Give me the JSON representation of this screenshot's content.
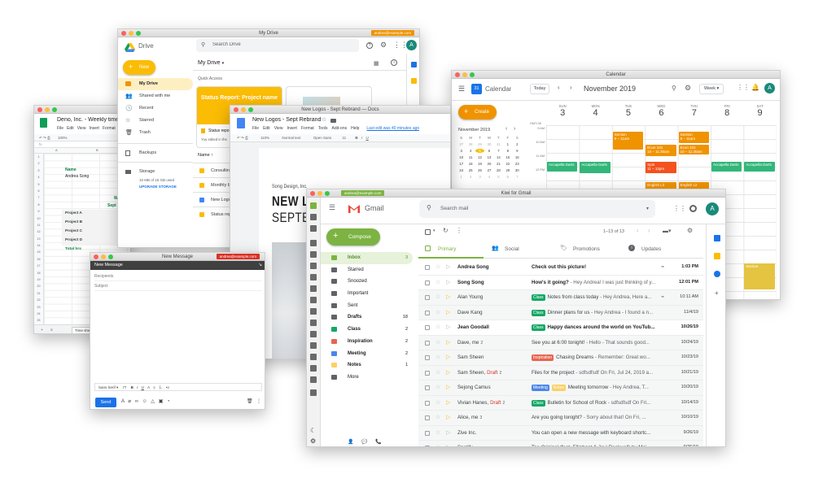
{
  "sheets": {
    "doc_title": "Deno, Inc. - Weekly time s",
    "menu": [
      "File",
      "Edit",
      "View",
      "Insert",
      "Format",
      "Da"
    ],
    "zoom": "100%",
    "fx": "fx",
    "name_label": "Name",
    "name_value": "Andrea Song",
    "partial_w": "W",
    "partial_sept": "Sept",
    "rows": [
      "Project A",
      "Project B",
      "Project C",
      "Project D",
      "Total hrs"
    ],
    "row_numbers": [
      "1",
      "2",
      "3",
      "4",
      "5",
      "6",
      "7",
      "8",
      "9",
      "10",
      "11",
      "12",
      "13",
      "14",
      "15",
      "16",
      "17",
      "18",
      "19",
      "20",
      "21",
      "22",
      "23",
      "24",
      "25"
    ],
    "cols": [
      "A",
      "B",
      "C"
    ],
    "tab_label": "Time she"
  },
  "drive": {
    "window_title": "My Drive",
    "tag": "andrea@example.com",
    "logo_text": "Drive",
    "search_placeholder": "Search Drive",
    "new_label": "New",
    "breadcrumb": "My Drive",
    "nav": [
      "My Drive",
      "Shared with me",
      "Recent",
      "Starred",
      "Trash",
      "Backups",
      "Storage"
    ],
    "storage_text": "10 MB of 15 GB used",
    "upgrade": "UPGRADE STORAGE",
    "quick_access": "Quick Access",
    "card_title": "Status Report: Project name",
    "card_file": "Status repo",
    "card_sub": "You edited in the",
    "name_header": "Name",
    "files": [
      "Consulting",
      "Monthly b",
      "New Logos",
      "Status rep"
    ],
    "avatar": "A"
  },
  "docs": {
    "title": "New Logos - Sept Rebrand",
    "window_title": "New Logos - Sept Rebrand — Docs",
    "menu": [
      "File",
      "Edit",
      "View",
      "Insert",
      "Format",
      "Tools",
      "Add-ons",
      "Help"
    ],
    "last_edit": "Last edit was 40 minutes ago",
    "zoom": "110%",
    "style": "Normal text",
    "font": "Open Sans",
    "size": "11",
    "heading_small": "Song Design, Inc.",
    "heading_big": "NEW LO",
    "heading_big2": "SEPTEM"
  },
  "calendar": {
    "window_title": "Calendar",
    "app_name": "Calendar",
    "badge_num": "31",
    "today": "Today",
    "month": "November 2019",
    "view": "Week",
    "avatar": "A",
    "create": "Create",
    "mini_month": "November 2019",
    "mini_days": [
      "S",
      "M",
      "T",
      "W",
      "T",
      "F",
      "S"
    ],
    "mini_dates": [
      "27",
      "28",
      "29",
      "30",
      "31",
      "1",
      "2",
      "3",
      "4",
      "5",
      "6",
      "7",
      "8",
      "9",
      "10",
      "11",
      "12",
      "13",
      "14",
      "15",
      "16",
      "17",
      "18",
      "19",
      "20",
      "21",
      "22",
      "23",
      "24",
      "25",
      "26",
      "27",
      "28",
      "29",
      "30",
      "1",
      "2",
      "3",
      "4",
      "5",
      "6",
      "7"
    ],
    "gmt": "GMT-08",
    "days": [
      {
        "name": "SUN",
        "num": "3"
      },
      {
        "name": "MON",
        "num": "4"
      },
      {
        "name": "TUE",
        "num": "5"
      },
      {
        "name": "WED",
        "num": "6"
      },
      {
        "name": "THU",
        "num": "7"
      },
      {
        "name": "FRI",
        "num": "8"
      },
      {
        "name": "SAT",
        "num": "9"
      }
    ],
    "times": [
      "9 AM",
      "10 AM",
      "11 AM",
      "12 PM"
    ],
    "events": [
      {
        "title": "Section",
        "time": "9 – 11am",
        "color": "#f09300"
      },
      {
        "title": "Section",
        "time": "9 – 11am",
        "color": "#f09300"
      },
      {
        "title": "Econ 101",
        "time": "10 – 11:30am",
        "color": "#f09300"
      },
      {
        "title": "Econ 101",
        "time": "10 – 11:30am",
        "color": "#f09300"
      },
      {
        "title": "Accapella Darts",
        "time": "",
        "color": "#33b679"
      },
      {
        "title": "Spin",
        "time": "11 – 12pm",
        "color": "#f4511e"
      },
      {
        "title": "Accapella Darts",
        "time": "",
        "color": "#33b679"
      },
      {
        "title": "Accapella Darts",
        "time": "",
        "color": "#33b679"
      },
      {
        "title": "Accapella Darts",
        "time": "",
        "color": "#33b679"
      },
      {
        "title": "English Lit",
        "time": "",
        "color": "#f09300"
      },
      {
        "title": "English Lit",
        "time": "",
        "color": "#f09300"
      },
      {
        "title": "Section",
        "time": "",
        "color": "#e4c441"
      }
    ]
  },
  "compose": {
    "window_title": "New Message",
    "tag": "andrea@example.com",
    "header": "New Message",
    "recipients": "Recipients",
    "subject": "Subject",
    "font": "Sans Serif",
    "send": "Send"
  },
  "gmail": {
    "window_title": "Kiwi for Gmail",
    "tag": "andrea@example.com",
    "logo_text": "Gmail",
    "search_placeholder": "Search mail",
    "avatar": "A",
    "compose": "Compose",
    "pager": "1–13 of 13",
    "tabs": [
      "Primary",
      "Social",
      "Promotions",
      "Updates"
    ],
    "nav": [
      {
        "label": "Inbox",
        "count": "3",
        "color": "#7cb342"
      },
      {
        "label": "Starred",
        "count": "",
        "color": "#5f6368"
      },
      {
        "label": "Snoozed",
        "count": "",
        "color": "#5f6368"
      },
      {
        "label": "Important",
        "count": "",
        "color": "#5f6368"
      },
      {
        "label": "Sent",
        "count": "",
        "color": "#5f6368"
      },
      {
        "label": "Drafts",
        "count": "18",
        "color": "#5f6368"
      },
      {
        "label": "Class",
        "count": "2",
        "color": "#16a765"
      },
      {
        "label": "Inspiration",
        "count": "2",
        "color": "#e66550"
      },
      {
        "label": "Meeting",
        "count": "2",
        "color": "#4a86e8"
      },
      {
        "label": "Notes",
        "count": "1",
        "color": "#fad165"
      },
      {
        "label": "More",
        "count": "",
        "color": "#5f6368"
      }
    ],
    "mails": [
      {
        "sender": "Andrea Song",
        "draft": "",
        "chips": [],
        "subject": "Check out this picture!",
        "snippet": "",
        "date": "1:03 PM",
        "unread": true
      },
      {
        "sender": "Song Song",
        "draft": "",
        "chips": [],
        "subject": "How's it going?",
        "snippet": " - Hey Andrea! I was just thinking of y...",
        "date": "12:01 PM",
        "unread": true
      },
      {
        "sender": "Alan Young",
        "draft": "",
        "chips": [
          {
            "label": "Class",
            "color": "#16a765"
          }
        ],
        "subject": "Notes from class today",
        "snippet": " - Hey Andrea, Here a...",
        "date": "10:11 AM",
        "unread": false
      },
      {
        "sender": "Dave Kang",
        "draft": "",
        "chips": [
          {
            "label": "Class",
            "color": "#16a765"
          }
        ],
        "subject": "Dinner plans for us",
        "snippet": " - Hey Andrea - I found a n...",
        "date": "11/4/19",
        "unread": false
      },
      {
        "sender": "Jean Goodall",
        "draft": "",
        "chips": [
          {
            "label": "Class",
            "color": "#16a765"
          }
        ],
        "subject": "Happy dances around the world on YouTub...",
        "snippet": "",
        "date": "10/26/19",
        "unread": true
      },
      {
        "sender": "Dave, me",
        "draft": "",
        "count": "2",
        "chips": [],
        "subject": "See you at 6:00 tonight!",
        "snippet": " - Hello - That sounds good...",
        "date": "10/24/19",
        "unread": false
      },
      {
        "sender": "Sam Sheen",
        "draft": "",
        "chips": [
          {
            "label": "Inspiration",
            "color": "#e66550"
          }
        ],
        "subject": "Chasing Dreams",
        "snippet": " - Remember: Great wo...",
        "date": "10/23/19",
        "unread": false
      },
      {
        "sender": "Sam Sheen,",
        "draft": "Draft",
        "count": "2",
        "chips": [],
        "subject": "Files for the project",
        "snippet": " - sdfsdfsdf On Fri, Jul 24, 2019 a...",
        "date": "10/21/19",
        "unread": false
      },
      {
        "sender": "Sejong Camus",
        "draft": "",
        "chips": [
          {
            "label": "Meeting",
            "color": "#4a86e8"
          },
          {
            "label": "Notes",
            "color": "#fad165"
          }
        ],
        "subject": "Meeting tomorrow",
        "snippet": " - Hey Andrea, T...",
        "date": "10/20/19",
        "unread": false
      },
      {
        "sender": "Vivian Hanes,",
        "draft": "Draft",
        "count": "2",
        "chips": [
          {
            "label": "Class",
            "color": "#16a765"
          }
        ],
        "subject": "Bulletin for School of Rock",
        "snippet": " - sdfsdfsdf On Fri...",
        "date": "10/14/19",
        "unread": false
      },
      {
        "sender": "Alice, me",
        "draft": "",
        "count": "3",
        "chips": [],
        "subject": "Are you going tonight?",
        "snippet": " - Sorry about that! On Fri, ...",
        "date": "10/10/19",
        "unread": false
      },
      {
        "sender": "Zive Inc.",
        "draft": "",
        "chips": [],
        "subject": "You can open a new message with keyboard shortc...",
        "snippet": "",
        "date": "9/26/19",
        "unread": false
      },
      {
        "sender": "Spotify",
        "draft": "",
        "chips": [],
        "subject": "Too Original (feat. Elliphant & Jovi Rockwell) by Maj...",
        "snippet": "",
        "date": "9/26/19",
        "unread": false
      }
    ]
  }
}
